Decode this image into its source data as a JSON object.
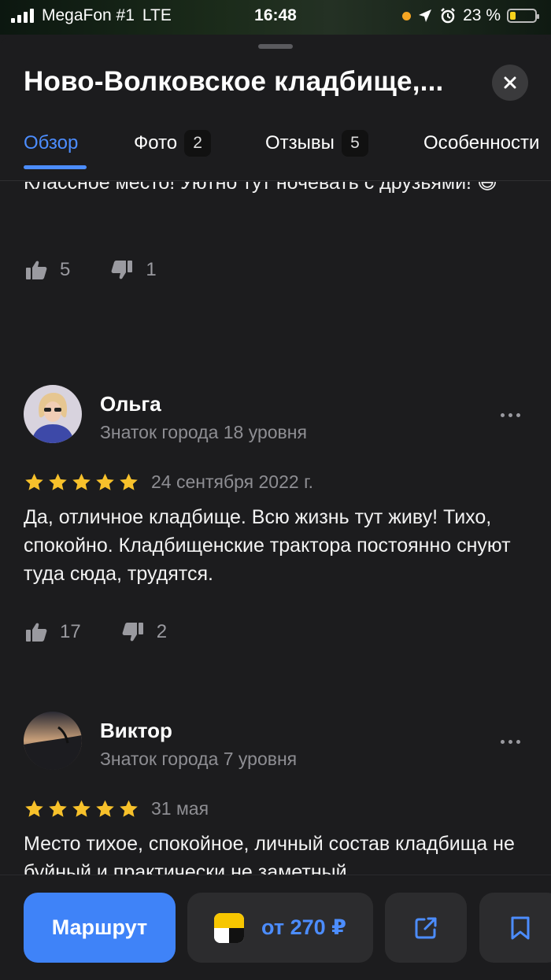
{
  "status_bar": {
    "carrier": "MegaFon #1",
    "network": "LTE",
    "time": "16:48",
    "battery": "23 %",
    "battery_level": 0.23
  },
  "sheet": {
    "title": "Ново-Волковское кладбище,...",
    "tabs": [
      {
        "label": "Обзор",
        "badge": null,
        "active": true
      },
      {
        "label": "Фото",
        "badge": "2",
        "active": false
      },
      {
        "label": "Отзывы",
        "badge": "5",
        "active": false
      },
      {
        "label": "Особенности",
        "badge": null,
        "active": false
      }
    ]
  },
  "reviews": [
    {
      "text": "Классное место! Уютно тут ночевать с друзьями! 😅",
      "likes": "5",
      "dislikes": "1"
    },
    {
      "author": "Ольга",
      "level": "Знаток города 18 уровня",
      "rating": 5,
      "date": "24 сентября 2022 г.",
      "text": "Да, отличное кладбище. Всю жизнь тут живу! Тихо,  спокойно. Кладбищенские трактора постоянно снуют туда сюда, трудятся.",
      "likes": "17",
      "dislikes": "2"
    },
    {
      "author": "Виктор",
      "level": "Знаток города 7 уровня",
      "rating": 5,
      "date": "31 мая",
      "text": "Место тихое, спокойное, личный состав кладбища не буйный и практически не заметный"
    }
  ],
  "bottom_bar": {
    "route_label": "Маршрут",
    "taxi_label": "от 270 ₽"
  },
  "colors": {
    "accent": "#3f83f8",
    "star": "#f7c12b",
    "background": "#1c1c1e"
  }
}
